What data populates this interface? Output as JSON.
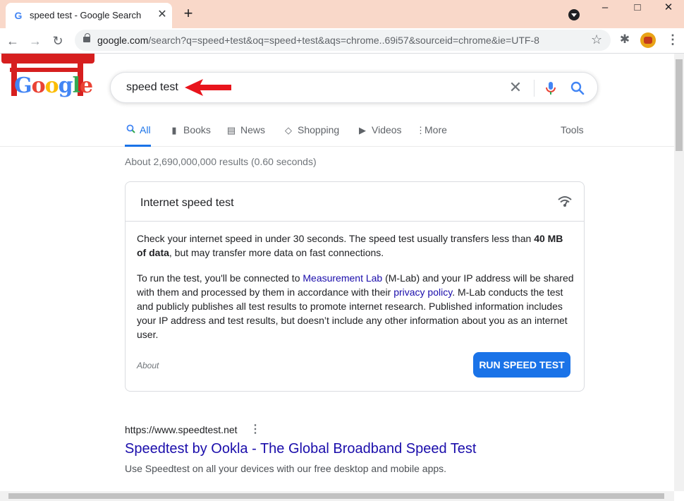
{
  "browser": {
    "tab_title": "speed test - Google Search",
    "tab_favicon": "G",
    "tab_close": "✕",
    "new_tab": "+",
    "window_controls": {
      "minimize": "–",
      "maximize": "□",
      "close": "✕"
    },
    "url_host": "google.com",
    "url_rest": "/search?q=speed+test&oq=speed+test&aqs=chrome..69i57&sourceid=chrome&ie=UTF-8",
    "back": "←",
    "forward": "→",
    "reload": "↻",
    "star": "☆",
    "extensions": "✱",
    "menu": "⋮"
  },
  "doodle": {
    "text": "Google"
  },
  "search": {
    "query": "speed test",
    "clear": "✕"
  },
  "tabs": [
    {
      "label": "All",
      "icon": "search-icon",
      "glyph": "Q"
    },
    {
      "label": "Books",
      "icon": "book-icon",
      "glyph": "▮"
    },
    {
      "label": "News",
      "icon": "news-icon",
      "glyph": "▤"
    },
    {
      "label": "Shopping",
      "icon": "tag-icon",
      "glyph": "◇"
    },
    {
      "label": "Videos",
      "icon": "play-icon",
      "glyph": "▶"
    },
    {
      "label": "More",
      "icon": "more-icon",
      "glyph": "⋮"
    }
  ],
  "tools_label": "Tools",
  "stats": "About 2,690,000,000 results (0.60 seconds)",
  "speedtest_card": {
    "title": "Internet speed test",
    "p1_a": "Check your internet speed in under 30 seconds. The speed test usually transfers less than ",
    "p1_bold": "40 MB of data",
    "p1_b": ", but may transfer more data on fast connections.",
    "p2_a": "To run the test, you'll be connected to ",
    "p2_link1": "Measurement Lab",
    "p2_b": " (M-Lab) and your IP address will be shared with them and processed by them in accordance with their ",
    "p2_link2": "privacy policy",
    "p2_c": ". M-Lab conducts the test and publicly publishes all test results to promote internet research. Published information includes your IP address and test results, but doesn’t include any other information about you as an internet user.",
    "about": "About",
    "button": "RUN SPEED TEST"
  },
  "result": {
    "url": "https://www.speedtest.net",
    "more": "⋮",
    "title": "Speedtest by Ookla - The Global Broadband Speed Test",
    "snippet": "Use Speedtest on all your devices with our free desktop and mobile apps."
  },
  "colors": {
    "accent": "#1a73e8",
    "link": "#1a0dab",
    "titlebar": "#f9d8c9",
    "annotation_arrow": "#e8141c"
  }
}
